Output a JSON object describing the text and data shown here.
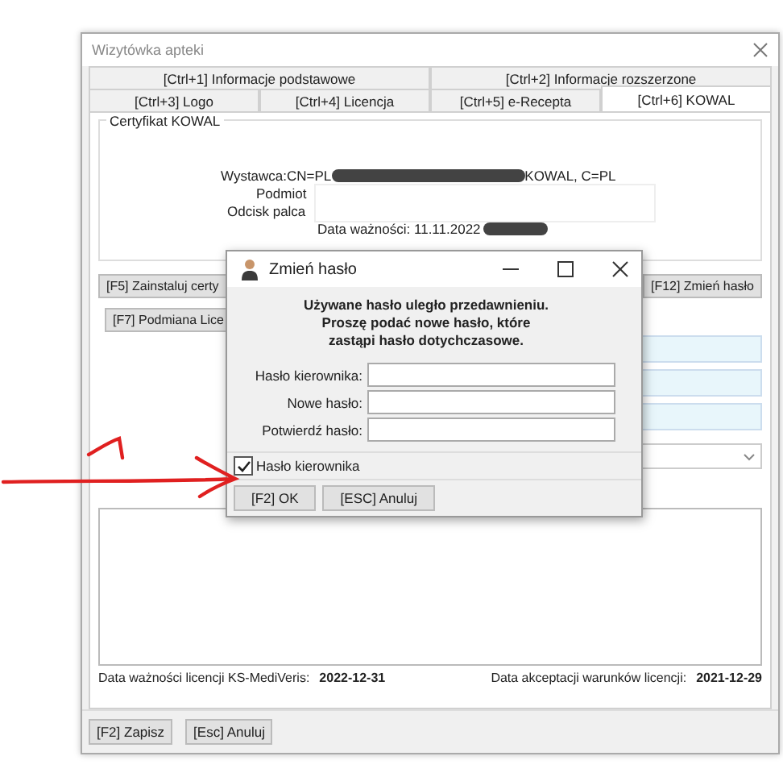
{
  "window": {
    "title": "Wizytówka apteki"
  },
  "tab_rows": [
    [
      {
        "label": "[Ctrl+1] Informacje podstawowe",
        "selected": false
      },
      {
        "label": "[Ctrl+2] Informacje rozszerzone",
        "selected": false
      }
    ],
    [
      {
        "label": "[Ctrl+3] Logo",
        "selected": false
      },
      {
        "label": "[Ctrl+4] Licencja",
        "selected": false
      },
      {
        "label": "[Ctrl+5] e-Recepta",
        "selected": false
      },
      {
        "label": "[Ctrl+6] KOWAL",
        "selected": true
      }
    ]
  ],
  "certificate": {
    "title": "Certyfikat KOWAL",
    "issuer_label": "Wystawca:",
    "issuer_start": "CN=PL",
    "issuer_end": "KOWAL, C=PL",
    "subject_label": "Podmiot",
    "fingerprint_label": "Odcisk palca",
    "validity": "Data ważności: 11.11.2022"
  },
  "buttons": {
    "install": "[F5] Zainstaluj certy",
    "change_password": "[F12] Zmień hasło",
    "swap_license": "[F7] Podmiana Lice"
  },
  "footer": {
    "license_label": "Data ważności licencji KS-MediVeris:",
    "license_date": "2022-12-31",
    "accept_label": "Data akceptacji warunków licencji:",
    "accept_date": "2021-12-29"
  },
  "actions": [
    "[F2] Zapisz",
    "[Esc] Anuluj"
  ],
  "dialog": {
    "title": "Zmień hasło",
    "message_lines": [
      "Używane hasło uległo przedawnieniu.",
      "Proszę podać nowe hasło, które",
      "zastąpi hasło dotychczasowe."
    ],
    "fields": [
      {
        "label": "Hasło kierownika:"
      },
      {
        "label": "Nowe hasło:"
      },
      {
        "label": "Potwierdź hasło:"
      }
    ],
    "checkbox": {
      "label": "Hasło kierownika",
      "checked": true
    },
    "buttons": [
      "[F2] OK",
      "[ESC] Anuluj"
    ]
  }
}
